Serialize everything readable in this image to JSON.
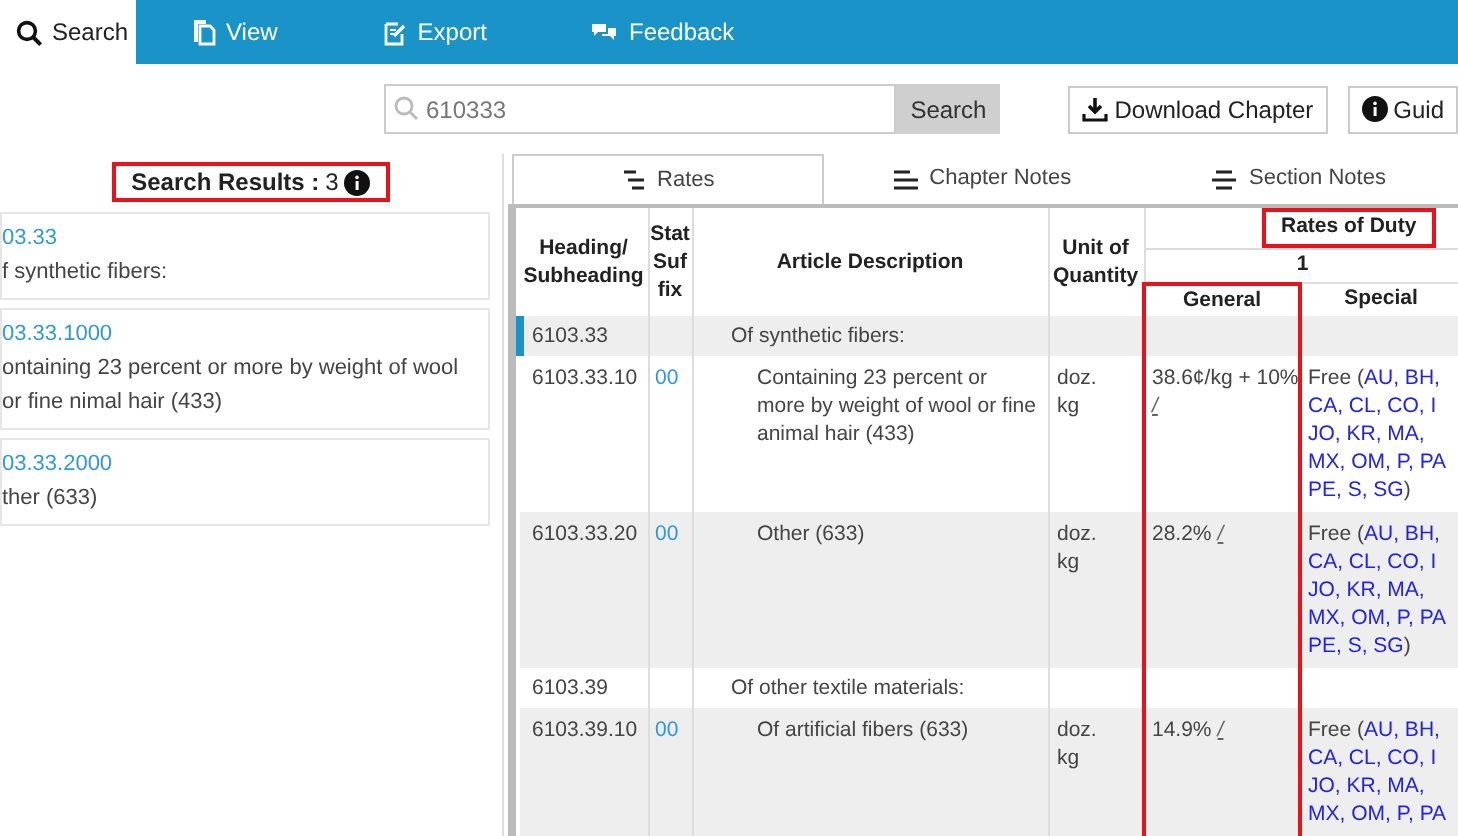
{
  "nav_tabs": [
    {
      "label": "Search",
      "selected": true
    },
    {
      "label": "View",
      "selected": false
    },
    {
      "label": "Export",
      "selected": false
    },
    {
      "label": "Feedback",
      "selected": false
    }
  ],
  "search": {
    "value": "610333",
    "button": "Search"
  },
  "toolbar_buttons": [
    {
      "label": "Download Chapter"
    },
    {
      "label": "Guid"
    }
  ],
  "results_header": {
    "label": "Search Results :",
    "count": "3",
    "highlighted": true
  },
  "results": [
    {
      "code": "03.33",
      "text": "f synthetic fibers:"
    },
    {
      "code": "03.33.1000",
      "text": "ontaining 23 percent or more by weight of wool or fine nimal hair (433)"
    },
    {
      "code": "03.33.2000",
      "text": "ther (633)"
    }
  ],
  "content_tabs": [
    {
      "label": "Rates",
      "selected": true
    },
    {
      "label": "Chapter Notes",
      "selected": false
    },
    {
      "label": "Section Notes",
      "selected": false
    }
  ],
  "table": {
    "columns": {
      "heading": "Heading/ Subheading",
      "stat": "Stat Suf fix",
      "description": "Article Description",
      "unit": "Unit of Quantity",
      "rates": "Rates of Duty",
      "rates_highlighted": true,
      "column_1": "1",
      "general": "General",
      "general_highlighted": true,
      "special": "Special"
    },
    "rows": [
      {
        "heading": "6103.33",
        "stat": "",
        "description": "Of synthetic fibers:",
        "kind": "subheading",
        "unit": [],
        "general": "",
        "general_link": "",
        "special_prefix": "",
        "special_lines": [],
        "special_suffix": "",
        "current": true
      },
      {
        "heading": "6103.33.10",
        "stat": "00",
        "description": "Containing 23 percent or more by weight of wool or fine animal hair (433)",
        "kind": "item",
        "unit": [
          "doz.",
          "kg"
        ],
        "general": "38.6¢/kg + 10%",
        "general_link": "/",
        "special_prefix": "Free (",
        "special_lines": [
          "AU, BH,",
          "CA, CL, CO, I",
          "JO, KR, MA,",
          "MX, OM, P, PA",
          "PE, S, SG"
        ],
        "special_suffix": ")",
        "current": false
      },
      {
        "heading": "6103.33.20",
        "stat": "00",
        "description": "Other (633)",
        "kind": "item",
        "unit": [
          "doz.",
          "kg"
        ],
        "general": "28.2%",
        "general_link": "/",
        "special_prefix": "Free (",
        "special_lines": [
          "AU, BH,",
          "CA, CL, CO, I",
          "JO, KR, MA,",
          "MX, OM, P, PA",
          "PE, S, SG"
        ],
        "special_suffix": ")",
        "current": false
      },
      {
        "heading": "6103.39",
        "stat": "",
        "description": "Of other textile materials:",
        "kind": "subheading",
        "unit": [],
        "general": "",
        "general_link": "",
        "special_prefix": "",
        "special_lines": [],
        "special_suffix": "",
        "current": false
      },
      {
        "heading": "6103.39.10",
        "stat": "00",
        "description": "Of artificial fibers (633)",
        "kind": "item",
        "unit": [
          "doz.",
          "kg"
        ],
        "general": "14.9%",
        "general_link": "/",
        "special_prefix": "Free (",
        "special_lines": [
          "AU, BH,",
          "CA, CL, CO, I",
          "JO, KR, MA,",
          "MX, OM, P, PA"
        ],
        "special_suffix": "",
        "current": false
      }
    ]
  }
}
